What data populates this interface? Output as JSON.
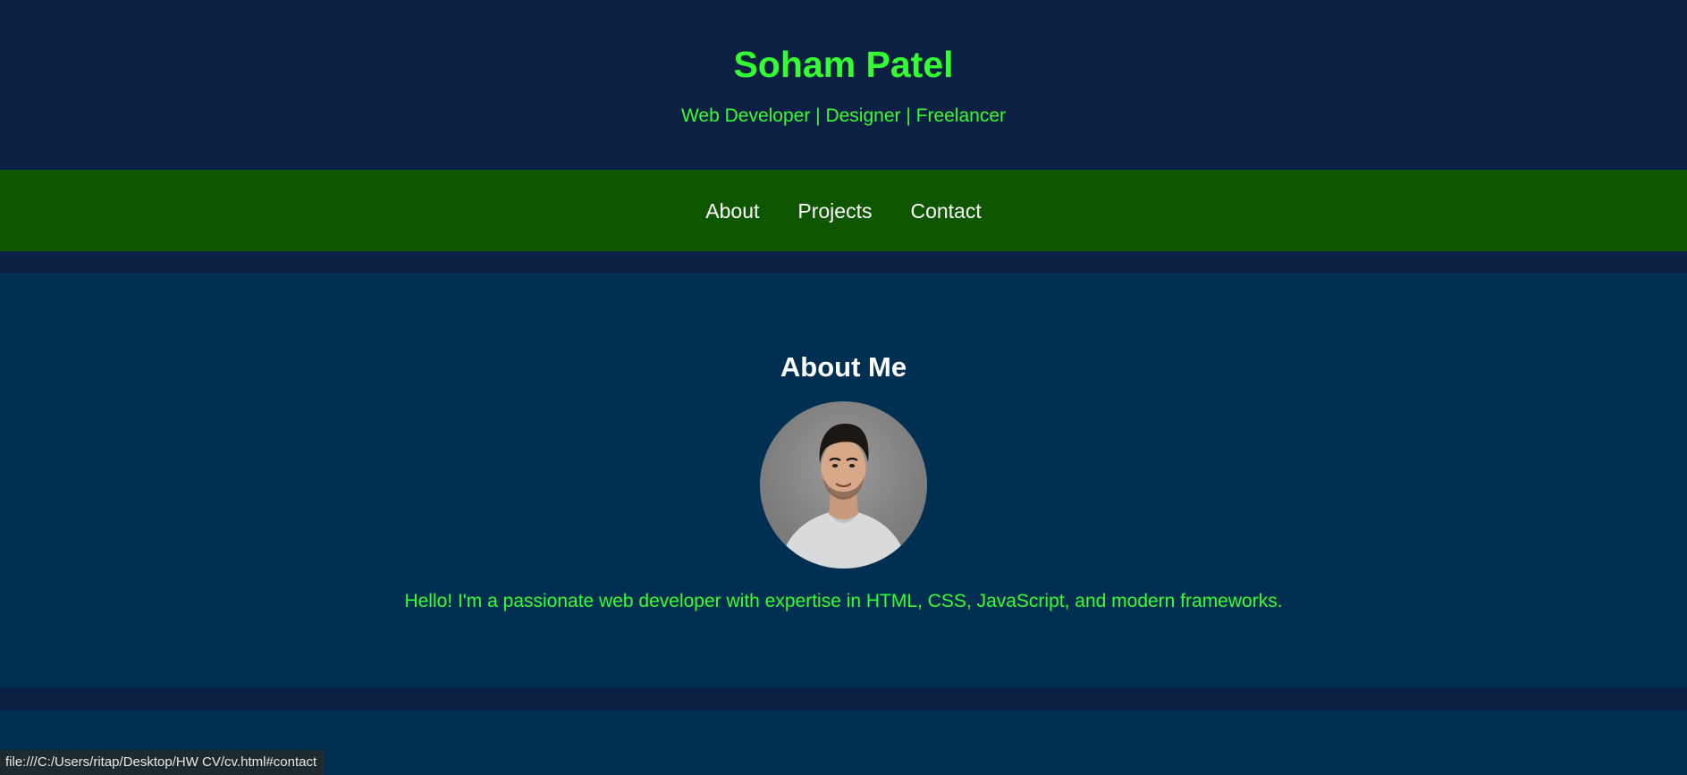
{
  "header": {
    "title": "Soham Patel",
    "subtitle": "Web Developer | Designer | Freelancer"
  },
  "nav": {
    "items": [
      {
        "label": "About"
      },
      {
        "label": "Projects"
      },
      {
        "label": "Contact"
      }
    ]
  },
  "about": {
    "heading": "About Me",
    "avatar_icon": "profile-photo",
    "text": "Hello! I'm a passionate web developer with expertise in HTML, CSS, JavaScript, and modern frameworks."
  },
  "status_bar": {
    "url": "file:///C:/Users/ritap/Desktop/HW CV/cv.html#contact"
  },
  "colors": {
    "accent_green": "#33ff33",
    "nav_bg": "#0e5600",
    "page_bg": "#0b2043",
    "section_bg": "#002f52"
  }
}
